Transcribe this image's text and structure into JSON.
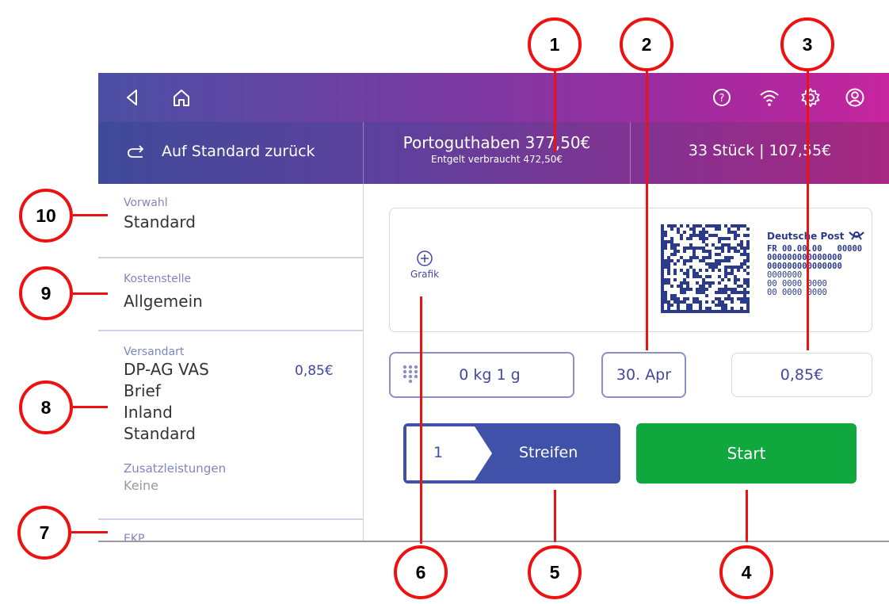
{
  "callouts": [
    "1",
    "2",
    "3",
    "4",
    "5",
    "6",
    "7",
    "8",
    "9",
    "10"
  ],
  "header": {
    "reset_label": "Auf Standard zurück",
    "postage_credit": "Portoguthaben 377,50€",
    "postage_used": "Entgelt verbraucht 472,50€",
    "piece_count": "33 Stück | 107,55€"
  },
  "sidebar": {
    "preset": {
      "label": "Vorwahl",
      "value": "Standard"
    },
    "cost_center": {
      "label": "Kostenstelle",
      "value": "Allgemein"
    },
    "shipping": {
      "label": "Versandart",
      "lines": [
        "DP-AG VAS",
        "Brief",
        "Inland",
        "Standard"
      ],
      "price": "0,85€",
      "extras_label": "Zusatzleistungen",
      "extras_value": "Keine"
    },
    "next_label": "EKP"
  },
  "stamp": {
    "add_graphic_label": "Grafik",
    "brand": "Deutsche Post",
    "code_line1": "FR 00.00.00   00000",
    "code_line2": "000000000000000",
    "code_line3": "000000000000000",
    "code_line4": "0000000",
    "code_line5": "00 0000 0000",
    "code_line6": "00 0000 0000"
  },
  "controls": {
    "weight": "0 kg 1 g",
    "date": "30. Apr",
    "postage": "0,85€",
    "count": "1",
    "mode_label": "Streifen",
    "start_label": "Start"
  },
  "colors": {
    "accent": "#3f51a8",
    "start": "#10a73f",
    "callout": "#e11111",
    "label": "#7f86bf"
  },
  "icons": [
    "back-icon",
    "home-icon",
    "help-icon",
    "wifi-icon",
    "settings-icon",
    "account-icon",
    "reset-icon",
    "plus-circle-icon",
    "keypad-icon",
    "post-horn-icon"
  ]
}
